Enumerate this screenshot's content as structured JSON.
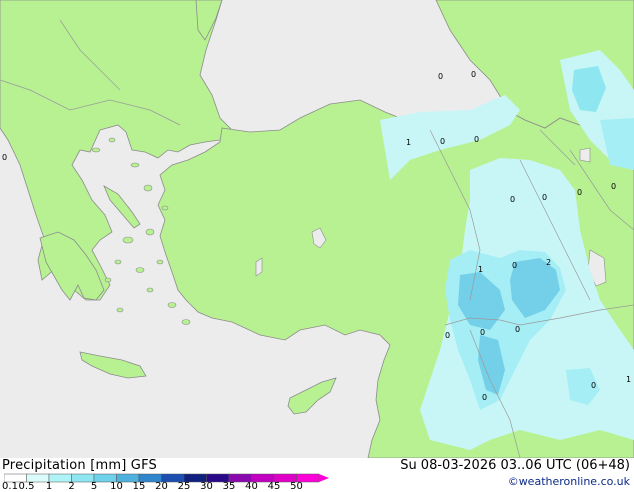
{
  "map": {
    "title": "Precipitation [mm] GFS",
    "datetime": "Su 08-03-2026 03..06 UTC (06+48)",
    "credit": "©weatheronline.co.uk",
    "colors": {
      "sea": "#ececec",
      "land": "#b7f191",
      "coast": "#8c8c8c",
      "border": "#9a9a9a"
    },
    "legend": {
      "labels": [
        "0.1",
        "0.5",
        "1",
        "2",
        "5",
        "10",
        "15",
        "20",
        "25",
        "30",
        "35",
        "40",
        "45",
        "50"
      ],
      "colors": [
        "#ffffff",
        "#dcfbfb",
        "#aef4f6",
        "#8ee6f0",
        "#6fd2ea",
        "#4fb2de",
        "#2f86cc",
        "#1c4fb0",
        "#10207f",
        "#2a0a8a",
        "#8a0ab0",
        "#c200c2",
        "#e000c8",
        "#ff00d8"
      ]
    },
    "cell_markers": [
      "0",
      "0",
      "1",
      "0",
      "0",
      "0",
      "0",
      "0",
      "0",
      "0",
      "1",
      "0",
      "2",
      "0",
      "0",
      "0",
      "0",
      "1",
      "0"
    ]
  }
}
